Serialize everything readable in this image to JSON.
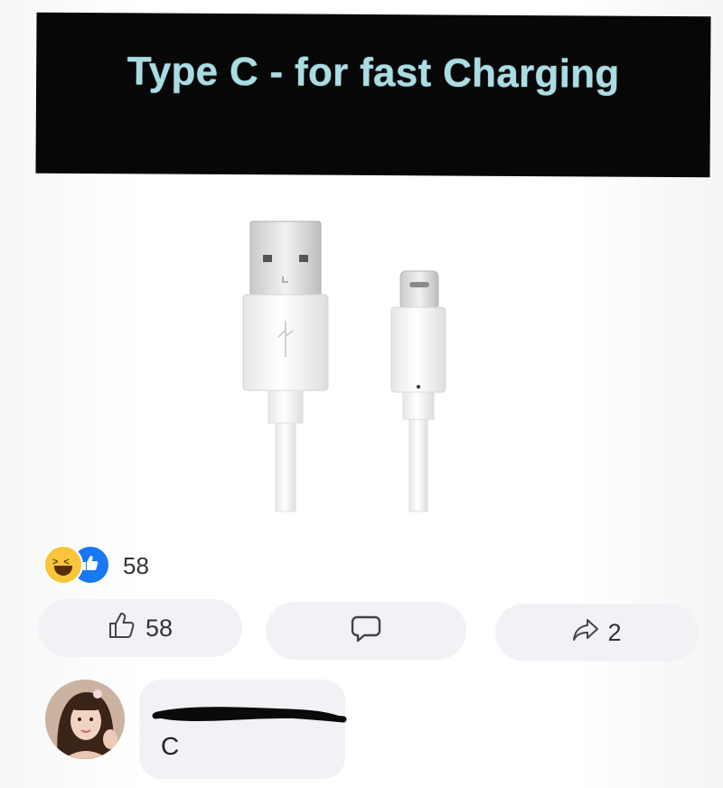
{
  "post": {
    "banner_text": "Type C - for fast Charging"
  },
  "reactions": {
    "icons": [
      "haha-reaction-icon",
      "like-reaction-icon"
    ],
    "count": "58"
  },
  "actions": {
    "like_count": "58",
    "share_count": "2"
  },
  "comment": {
    "text": "C"
  },
  "colors": {
    "banner_bg": "#070707",
    "banner_text": "#a9dde3",
    "like_blue": "#1877f2",
    "haha_yellow": "#f8c53c",
    "button_bg": "#f0f2f5"
  }
}
